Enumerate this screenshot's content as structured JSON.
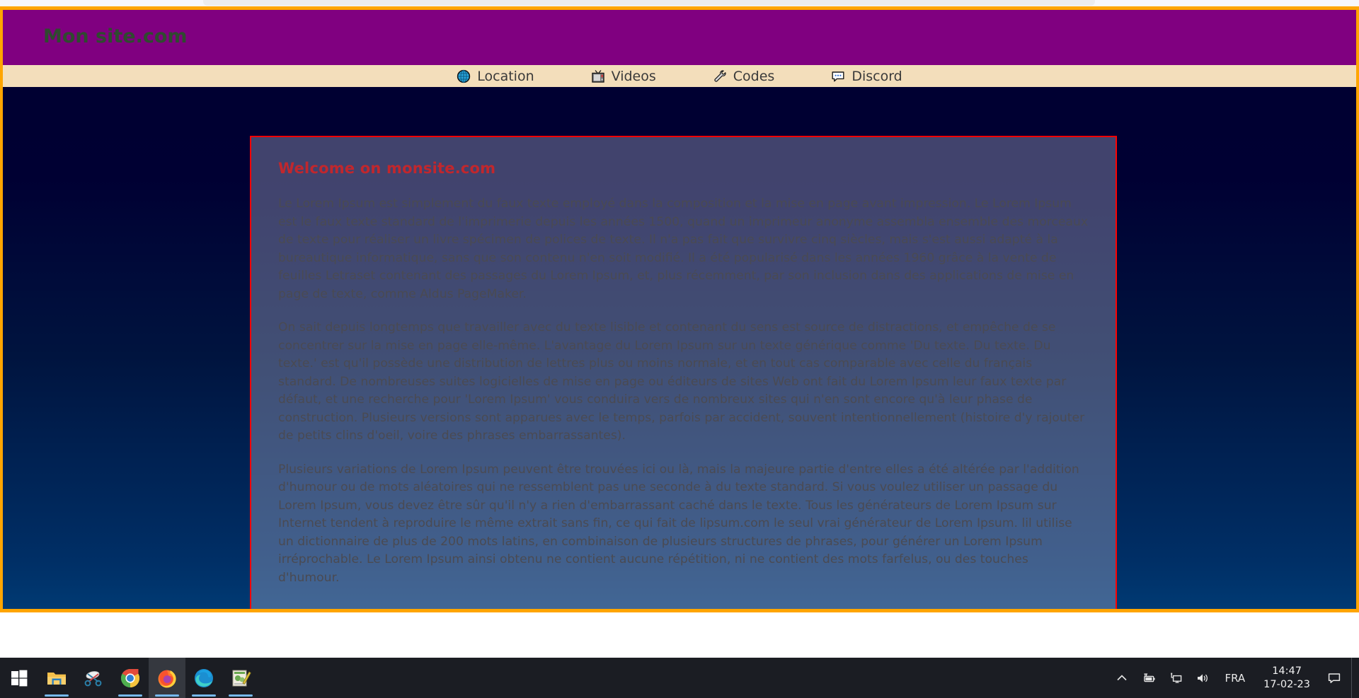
{
  "browser": {
    "chrome_visible": true
  },
  "site": {
    "title": "Mon site.com",
    "title_color": "#2f4a2f",
    "header_bg": "#800080",
    "nav_bg": "#f3debb",
    "page_border_color": "#ffa500",
    "nav": [
      {
        "label": "Location",
        "icon": "globe-icon"
      },
      {
        "label": "Videos",
        "icon": "television-icon"
      },
      {
        "label": "Codes",
        "icon": "wrench-icon"
      },
      {
        "label": "Discord",
        "icon": "chat-bubble-icon"
      }
    ],
    "card": {
      "border_color": "#ff0000",
      "title": "Welcome on monsite.com",
      "title_color": "#c1272d",
      "paragraphs": [
        "Le Lorem Ipsum est simplement du faux texte employé dans la composition et la mise en page avant impression. Le Lorem Ipsum est le faux texte standard de l'imprimerie depuis les années 1500, quand un imprimeur anonyme assembla ensemble des morceaux de texte pour réaliser un livre spécimen de polices de texte. Il n'a pas fait que survivre cinq siècles, mais s'est aussi adapté à la bureautique informatique, sans que son contenu n'en soit modifié. Il a été popularisé dans les années 1960 grâce à la vente de feuilles Letraset contenant des passages du Lorem Ipsum, et, plus récemment, par son inclusion dans des applications de mise en page de texte, comme Aldus PageMaker.",
        "On sait depuis longtemps que travailler avec du texte lisible et contenant du sens est source de distractions, et empêche de se concentrer sur la mise en page elle-même. L'avantage du Lorem Ipsum sur un texte générique comme 'Du texte. Du texte. Du texte.' est qu'il possède une distribution de lettres plus ou moins normale, et en tout cas comparable avec celle du français standard. De nombreuses suites logicielles de mise en page ou éditeurs de sites Web ont fait du Lorem Ipsum leur faux texte par défaut, et une recherche pour 'Lorem Ipsum' vous conduira vers de nombreux sites qui n'en sont encore qu'à leur phase de construction. Plusieurs versions sont apparues avec le temps, parfois par accident, souvent intentionnellement (histoire d'y rajouter de petits clins d'oeil, voire des phrases embarrassantes).",
        "Plusieurs variations de Lorem Ipsum peuvent être trouvées ici ou là, mais la majeure partie d'entre elles a été altérée par l'addition d'humour ou de mots aléatoires qui ne ressemblent pas une seconde à du texte standard. Si vous voulez utiliser un passage du Lorem Ipsum, vous devez être sûr qu'il n'y a rien d'embarrassant caché dans le texte. Tous les générateurs de Lorem Ipsum sur Internet tendent à reproduire le même extrait sans fin, ce qui fait de lipsum.com le seul vrai générateur de Lorem Ipsum. lil utilise un dictionnaire de plus de 200 mots latins, en combinaison de plusieurs structures de phrases, pour générer un Lorem Ipsum irréprochable. Le Lorem Ipsum ainsi obtenu ne contient aucune répétition, ni ne contient des mots farfelus, ou des touches d'humour."
      ]
    }
  },
  "taskbar": {
    "bg": "#1b1d23",
    "buttons": [
      {
        "name": "start-button",
        "icon": "windows-logo-icon",
        "running": false,
        "active": false
      },
      {
        "name": "file-explorer-button",
        "icon": "folder-icon",
        "running": true,
        "active": false
      },
      {
        "name": "snipping-tool-button",
        "icon": "scissors-icon",
        "running": false,
        "active": false
      },
      {
        "name": "chrome-button",
        "icon": "chrome-icon",
        "running": true,
        "active": false
      },
      {
        "name": "firefox-button",
        "icon": "firefox-icon",
        "running": true,
        "active": true
      },
      {
        "name": "edge-button",
        "icon": "edge-icon",
        "running": true,
        "active": false
      },
      {
        "name": "notepadpp-button",
        "icon": "notepadpp-icon",
        "running": true,
        "active": false
      }
    ],
    "tray": {
      "overflow_icon": "chevron-up-icon",
      "icons": [
        {
          "name": "battery-charging-icon"
        },
        {
          "name": "network-icon"
        },
        {
          "name": "volume-icon"
        }
      ],
      "language": "FRA",
      "time": "14:47",
      "date": "17-02-23",
      "notification_icon": "notification-bubble-icon"
    }
  }
}
